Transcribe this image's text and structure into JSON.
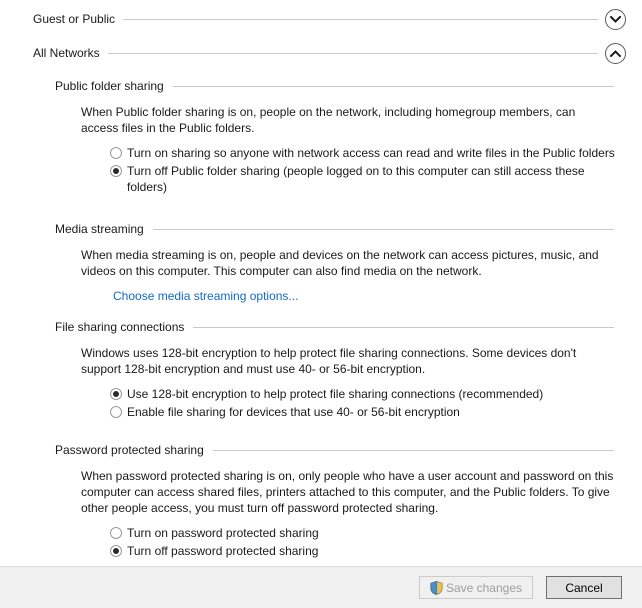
{
  "sections": [
    {
      "id": "guest-or-public",
      "title": "Guest or Public",
      "expanded": false,
      "chevron_icon": "chevron-down-icon"
    },
    {
      "id": "all-networks",
      "title": "All Networks",
      "expanded": true,
      "chevron_icon": "chevron-up-icon"
    }
  ],
  "subsections": {
    "public_folder_sharing": {
      "title": "Public folder sharing",
      "description": "When Public folder sharing is on, people on the network, including homegroup members, can access files in the Public folders.",
      "options": [
        {
          "label": "Turn on sharing so anyone with network access can read and write files in the Public folders",
          "selected": false
        },
        {
          "label": "Turn off Public folder sharing (people logged on to this computer can still access these folders)",
          "selected": true
        }
      ]
    },
    "media_streaming": {
      "title": "Media streaming",
      "description": "When media streaming is on, people and devices on the network can access pictures, music, and videos on this computer. This computer can also find media on the network.",
      "link_label": "Choose media streaming options..."
    },
    "file_sharing_connections": {
      "title": "File sharing connections",
      "description": "Windows uses 128-bit encryption to help protect file sharing connections. Some devices don't support 128-bit encryption and must use 40- or 56-bit encryption.",
      "options": [
        {
          "label": "Use 128-bit encryption to help protect file sharing connections (recommended)",
          "selected": true
        },
        {
          "label": "Enable file sharing for devices that use 40- or 56-bit encryption",
          "selected": false
        }
      ]
    },
    "password_protected_sharing": {
      "title": "Password protected sharing",
      "description": "When password protected sharing is on, only people who have a user account and password on this computer can access shared files, printers attached to this computer, and the Public folders. To give other people access, you must turn off password protected sharing.",
      "options": [
        {
          "label": "Turn on password protected sharing",
          "selected": false
        },
        {
          "label": "Turn off password protected sharing",
          "selected": true
        }
      ]
    }
  },
  "footer": {
    "save_label": "Save changes",
    "save_enabled": false,
    "save_icon": "uac-shield-icon",
    "cancel_label": "Cancel"
  },
  "colors": {
    "link": "#1569c7",
    "rule": "#c8c8c8",
    "footer_bg": "#f0f0f0",
    "text": "#1a1a1a",
    "shield_blue": "#4a90c4",
    "shield_gold": "#e8c15a"
  }
}
